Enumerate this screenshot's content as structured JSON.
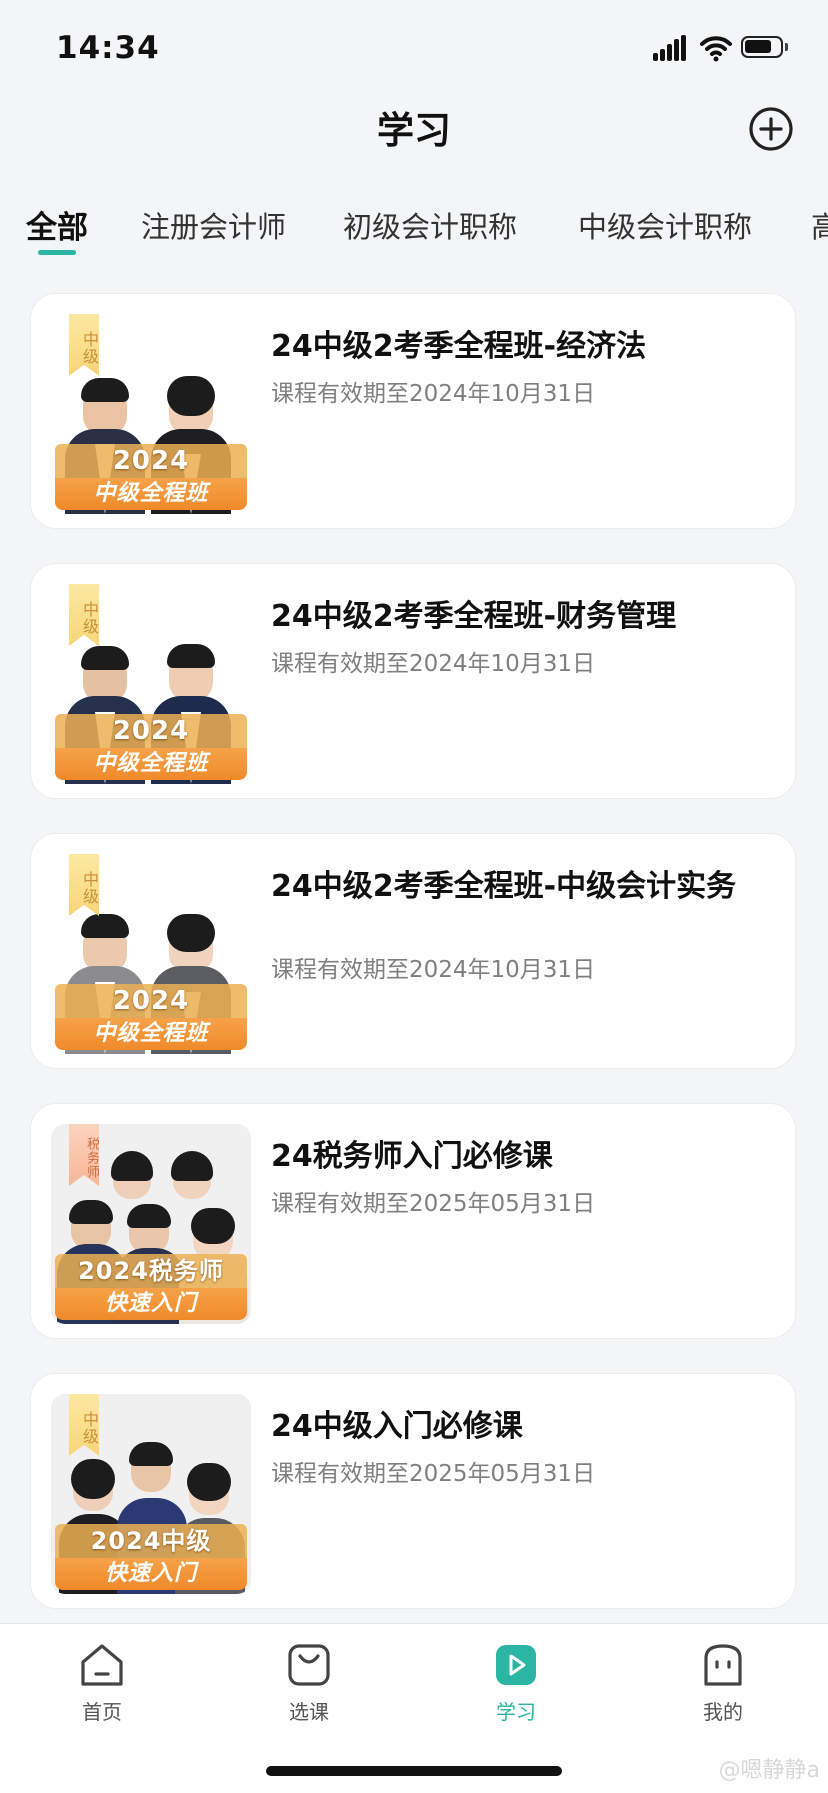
{
  "status_bar": {
    "time": "14:34"
  },
  "header": {
    "title": "学习",
    "add_icon": "plus-circle-icon"
  },
  "tabs": [
    {
      "label": "全部",
      "active": true
    },
    {
      "label": "注册会计师"
    },
    {
      "label": "初级会计职称"
    },
    {
      "label": "中级会计职称"
    },
    {
      "label": "高"
    }
  ],
  "courses": [
    {
      "title": "24中级2考季全程班-经济法",
      "expiry": "课程有效期至2024年10月31日",
      "thumb": {
        "tag": "中级",
        "banner_top": "2024",
        "banner_bottom": "中级全程班"
      }
    },
    {
      "title": "24中级2考季全程班-财务管理",
      "expiry": "课程有效期至2024年10月31日",
      "thumb": {
        "tag": "中级",
        "banner_top": "2024",
        "banner_bottom": "中级全程班"
      }
    },
    {
      "title": "24中级2考季全程班-中级会计实务",
      "expiry": "课程有效期至2024年10月31日",
      "thumb": {
        "tag": "中级",
        "banner_top": "2024",
        "banner_bottom": "中级全程班"
      }
    },
    {
      "title": "24税务师入门必修课",
      "expiry": "课程有效期至2025年05月31日",
      "thumb": {
        "tag": "税务师",
        "banner_top": "2024税务师",
        "banner_bottom": "快速入门"
      }
    },
    {
      "title": "24中级入门必修课",
      "expiry": "课程有效期至2025年05月31日",
      "thumb": {
        "tag": "中级",
        "banner_top": "2024中级",
        "banner_bottom": "快速入门"
      }
    }
  ],
  "bottom_nav": [
    {
      "label": "首页",
      "icon": "home-icon"
    },
    {
      "label": "选课",
      "icon": "shopping-bag-icon"
    },
    {
      "label": "学习",
      "icon": "play-icon",
      "active": true
    },
    {
      "label": "我的",
      "icon": "profile-face-icon"
    }
  ],
  "watermark": "@嗯静静a",
  "colors": {
    "accent": "#2bb5a3",
    "banner_orange": "#ef8a2a"
  }
}
